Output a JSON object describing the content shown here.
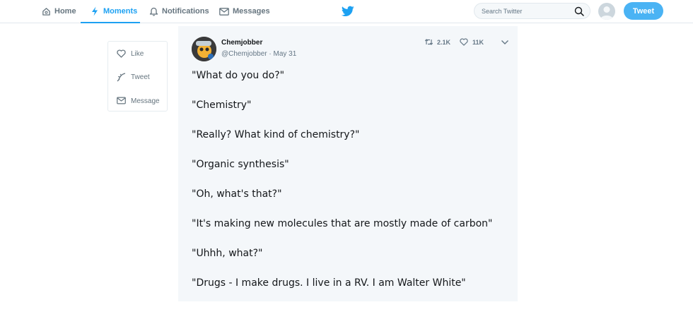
{
  "nav": {
    "home": "Home",
    "moments": "Moments",
    "notifications": "Notifications",
    "messages": "Messages",
    "active": "moments"
  },
  "search": {
    "placeholder": "Search Twitter"
  },
  "tweet_button": "Tweet",
  "side_actions": {
    "like": "Like",
    "tweet": "Tweet",
    "message": "Message"
  },
  "tweet": {
    "author_name": "Chemjobber",
    "handle": "@Chemjobber",
    "separator": " · ",
    "date": "May 31",
    "retweets": "2.1K",
    "likes": "11K",
    "lines": [
      "\"What do you do?\"",
      "\"Chemistry\"",
      "\"Really? What kind of chemistry?\"",
      "\"Organic synthesis\"",
      "\"Oh, what's that?\"",
      "\"It's making new molecules that are mostly made of carbon\"",
      "\"Uhhh, what?\"",
      "\"Drugs - I make drugs. I live in a RV. I am Walter White\""
    ]
  },
  "icons": {
    "home": "home-icon",
    "moments": "lightning-icon",
    "notifications": "bell-icon",
    "messages": "envelope-icon",
    "logo": "twitter-bird-icon",
    "search": "search-icon",
    "like": "heart-icon",
    "tweet": "feather-icon",
    "message": "envelope-icon",
    "retweet": "retweet-icon",
    "caret": "chevron-down-icon"
  },
  "colors": {
    "accent": "#1da1f2",
    "tweet_button": "#4ab3f4",
    "muted": "#657786",
    "card_bg": "#f4f7fa"
  }
}
